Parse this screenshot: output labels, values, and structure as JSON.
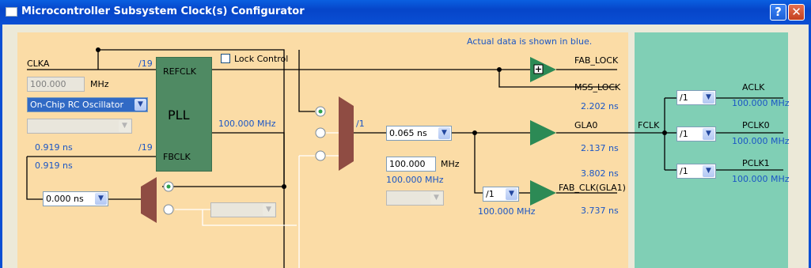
{
  "window": {
    "title": "Microcontroller Subsystem Clock(s) Configurator",
    "help_label": "?",
    "close_label": "✕"
  },
  "note": "Actual data is shown in blue.",
  "clka": {
    "label": "CLKA",
    "div_top": "/19",
    "freq_value": "100.000",
    "freq_unit": "MHz",
    "source": "On-Chip RC Oscillator",
    "source_sub": ""
  },
  "pll": {
    "label": "PLL",
    "refclk": "REFCLK",
    "fbclk": "FBCLK",
    "out_freq": "100.000 MHz",
    "div_fb": "/19",
    "delay_a": "0.919 ns",
    "delay_b": "0.919 ns"
  },
  "lock_control": {
    "label": "Lock Control",
    "checked": false
  },
  "feedback": {
    "delay": "0.000 ns",
    "select": ""
  },
  "mux": {
    "div": "/1",
    "delay": "0.065 ns",
    "freq_value": "100.000",
    "freq_unit": "MHz",
    "actual_freq": "100.000 MHz",
    "select": ""
  },
  "outputs": {
    "fab_lock": {
      "label": "FAB_LOCK"
    },
    "mss_lock": {
      "label": "MSS_LOCK",
      "delay": "2.202 ns"
    },
    "gla0": {
      "label": "GLA0",
      "delay": "2.137 ns",
      "delay2": "3.802 ns"
    },
    "fab_clk": {
      "label": "FAB_CLK(GLA1)",
      "div": "/1",
      "freq": "100.000 MHz",
      "delay": "3.737 ns"
    }
  },
  "fclk": {
    "label": "FCLK",
    "clocks": [
      {
        "label": "ACLK",
        "div": "/1",
        "freq": "100.000 MHz"
      },
      {
        "label": "PCLK0",
        "div": "/1",
        "freq": "100.000 MHz"
      },
      {
        "label": "PCLK1",
        "div": "/1",
        "freq": "100.000 MHz"
      }
    ]
  },
  "colors": {
    "panel": "#fbdca6",
    "fclk_panel": "#80cfb5",
    "pll": "#4f8a63",
    "buffer": "#2c8a55",
    "mux": "#8f4c43",
    "actual_data": "#1b56c5"
  },
  "icons": [
    "help-icon",
    "close-icon",
    "window-icon",
    "dropdown-arrow-icon",
    "radio-icon",
    "checkbox-icon"
  ]
}
